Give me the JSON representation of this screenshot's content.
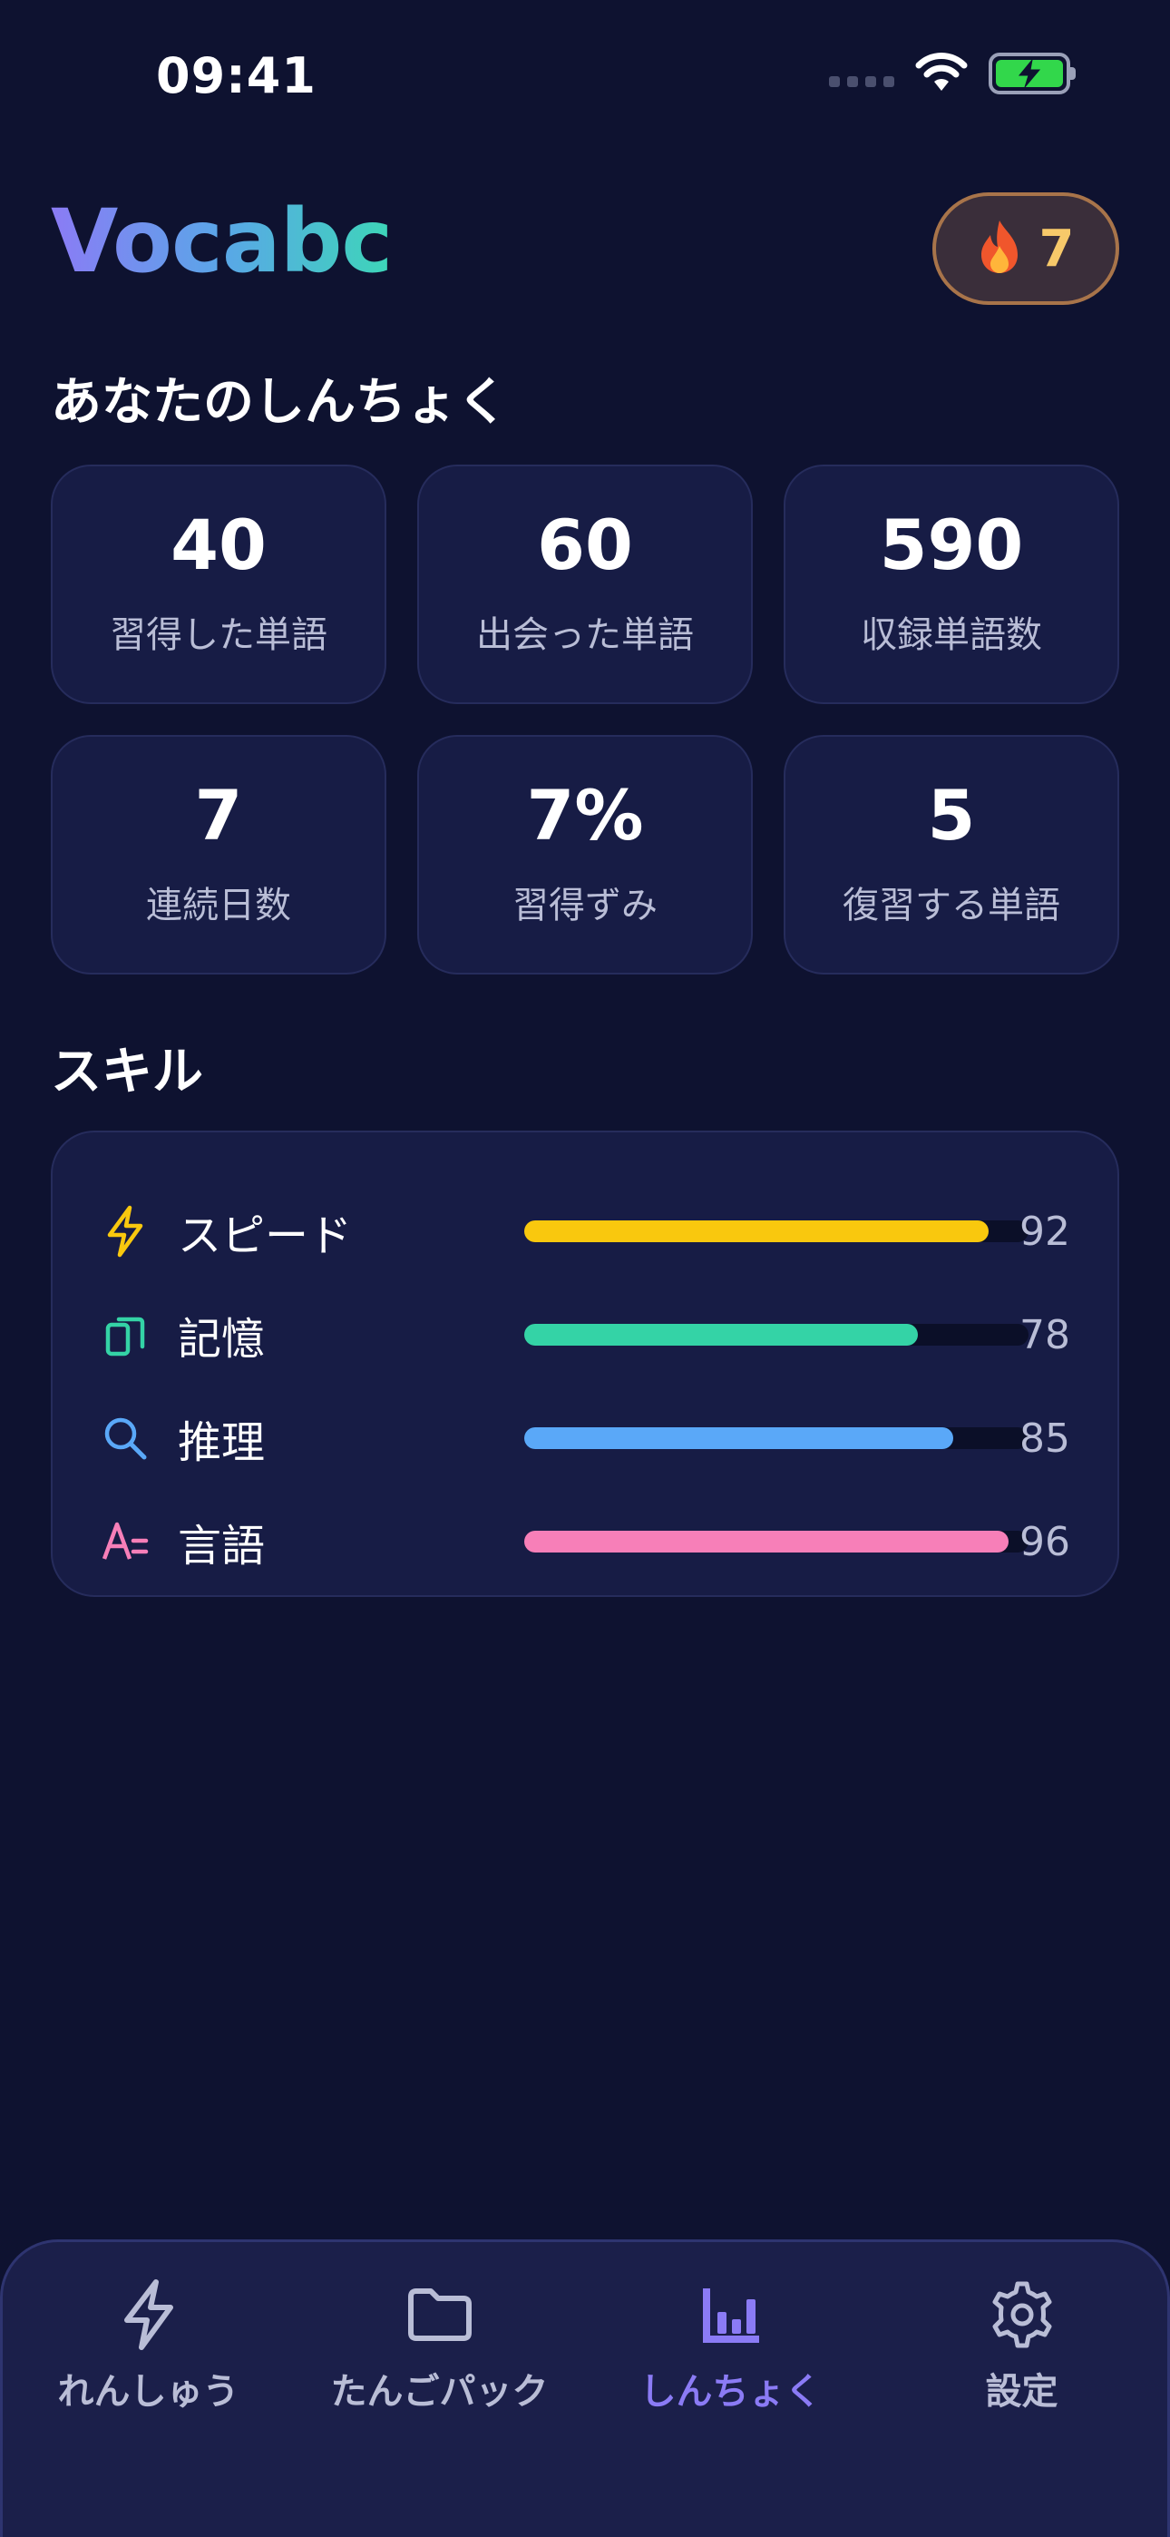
{
  "status": {
    "time": "09:41"
  },
  "header": {
    "logo": "Vocabc",
    "streak": "7"
  },
  "progress": {
    "title": "あなたのしんちょく",
    "stats": [
      {
        "value": "40",
        "label": "習得した単語"
      },
      {
        "value": "60",
        "label": "出会った単語"
      },
      {
        "value": "590",
        "label": "収録単語数"
      },
      {
        "value": "7",
        "label": "連続日数"
      },
      {
        "value": "7%",
        "label": "習得ずみ"
      },
      {
        "value": "5",
        "label": "復習する単語"
      }
    ]
  },
  "skills": {
    "title": "スキル",
    "items": [
      {
        "name": "スピード",
        "value": "92",
        "percent": 92,
        "icon": "lightning-icon",
        "color": "#f9c80e"
      },
      {
        "name": "記憶",
        "value": "78",
        "percent": 78,
        "icon": "memory-cards-icon",
        "color": "#34d3a6"
      },
      {
        "name": "推理",
        "value": "85",
        "percent": 85,
        "icon": "search-icon",
        "color": "#5aa8f8"
      },
      {
        "name": "言語",
        "value": "96",
        "percent": 96,
        "icon": "language-icon",
        "color": "#f77fb8"
      }
    ]
  },
  "nav": {
    "items": [
      {
        "label": "れんしゅう",
        "icon": "lightning-icon"
      },
      {
        "label": "たんごパック",
        "icon": "folder-icon"
      },
      {
        "label": "しんちょく",
        "icon": "chart-icon",
        "active": true
      },
      {
        "label": "設定",
        "icon": "gear-icon"
      }
    ]
  },
  "colors": {
    "background": "#0e1230",
    "card": "#171c45",
    "accent": "#8b7bf5",
    "streak_text": "#f7c96a"
  }
}
